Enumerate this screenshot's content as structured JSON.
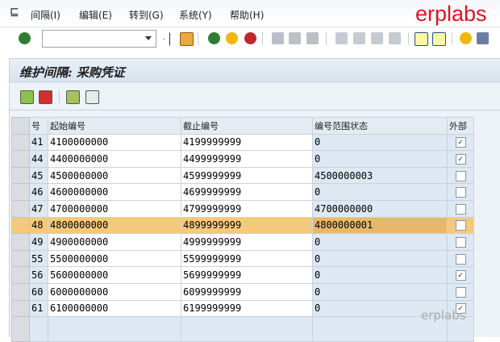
{
  "menu": [
    "间隔(I)",
    "编辑(E)",
    "转到(G)",
    "系统(Y)",
    "帮助(H)"
  ],
  "brand": "erplabs",
  "command_field": {
    "value": ""
  },
  "title": "维护间隔: 采购凭证",
  "table": {
    "headers": [
      "号",
      "起始编号",
      "截止编号",
      "编号范围状态",
      "外部"
    ],
    "rows": [
      {
        "no": "41",
        "from": "4100000000",
        "to": "4199999999",
        "status": "0",
        "ext": true
      },
      {
        "no": "44",
        "from": "4400000000",
        "to": "4499999999",
        "status": "0",
        "ext": true
      },
      {
        "no": "45",
        "from": "4500000000",
        "to": "4599999999",
        "status": "4500000003",
        "ext": false
      },
      {
        "no": "46",
        "from": "4600000000",
        "to": "4699999999",
        "status": "0",
        "ext": false
      },
      {
        "no": "47",
        "from": "4700000000",
        "to": "4799999999",
        "status": "4700000000",
        "ext": false
      },
      {
        "no": "48",
        "from": "4800000000",
        "to": "4899999999",
        "status": "4800000001",
        "ext": false
      },
      {
        "no": "49",
        "from": "4900000000",
        "to": "4999999999",
        "status": "0",
        "ext": false
      },
      {
        "no": "55",
        "from": "5500000000",
        "to": "5599999999",
        "status": "0",
        "ext": false
      },
      {
        "no": "56",
        "from": "5600000000",
        "to": "5699999999",
        "status": "0",
        "ext": true
      },
      {
        "no": "60",
        "from": "6000000000",
        "to": "6099999999",
        "status": "0",
        "ext": false
      },
      {
        "no": "61",
        "from": "6100000000",
        "to": "6199999999",
        "status": "0",
        "ext": true
      }
    ]
  },
  "watermark": "erplabs"
}
